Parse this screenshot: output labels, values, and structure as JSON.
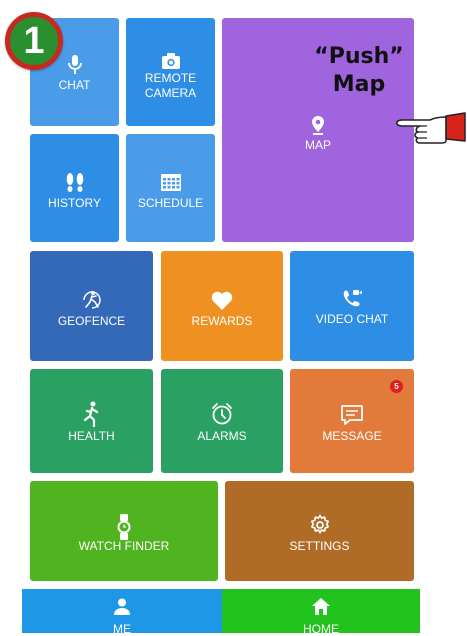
{
  "step_badge": "1",
  "callout": {
    "line1": "“Push”",
    "line2": "Map"
  },
  "tiles": {
    "chat": {
      "label": "CHAT",
      "icon": "microphone-icon",
      "color": "#4a9be8"
    },
    "remote_camera": {
      "label_line1": "REMOTE",
      "label_line2": "CAMERA",
      "icon": "camera-icon",
      "color": "#2e8ee5"
    },
    "map": {
      "label": "MAP",
      "icon": "map-pin-icon",
      "color": "#a064de"
    },
    "history": {
      "label": "HISTORY",
      "icon": "footprints-icon",
      "color": "#2e8ee5"
    },
    "schedule": {
      "label": "SCHEDULE",
      "icon": "calendar-grid-icon",
      "color": "#4a9be8"
    },
    "geofence": {
      "label": "GEOFENCE",
      "icon": "geofence-runner-icon",
      "color": "#3468b8"
    },
    "rewards": {
      "label": "REWARDS",
      "icon": "heart-icon",
      "color": "#ee9120"
    },
    "video_chat": {
      "label": "VIDEO CHAT",
      "icon": "video-phone-icon",
      "color": "#2e8ee5"
    },
    "health": {
      "label": "HEALTH",
      "icon": "running-person-icon",
      "color": "#2aa162"
    },
    "alarms": {
      "label": "ALARMS",
      "icon": "alarm-clock-icon",
      "color": "#2aa162"
    },
    "message": {
      "label": "MESSAGE",
      "icon": "message-icon",
      "color": "#e27a3c",
      "badge": "5"
    },
    "watch_finder": {
      "label": "WATCH FINDER",
      "icon": "watch-icon",
      "color": "#50b320"
    },
    "settings": {
      "label": "SETTINGS",
      "icon": "gear-icon",
      "color": "#b06c26"
    }
  },
  "bottom_nav": {
    "me": {
      "label": "ME",
      "icon": "person-icon",
      "color": "#1e98e6"
    },
    "home": {
      "label": "HOME",
      "icon": "home-icon",
      "color": "#22c31c"
    }
  }
}
